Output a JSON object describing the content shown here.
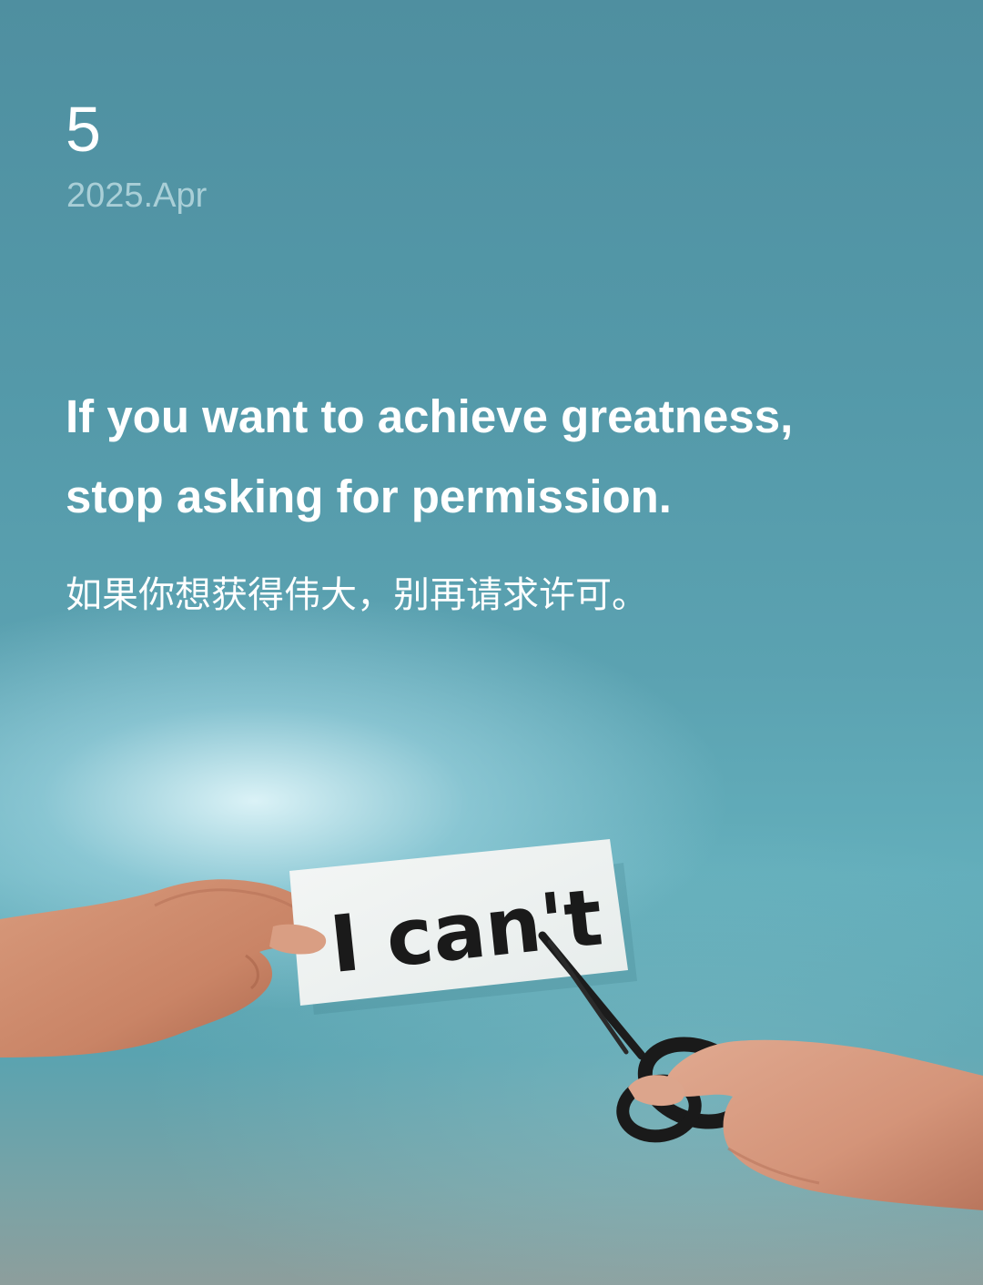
{
  "date": {
    "day": "5",
    "month_year": "2025.Apr"
  },
  "quote": {
    "english_line_1": "If you want to achieve greatness,",
    "english_line_2": "stop asking for permission.",
    "chinese": "如果你想获得伟大，别再请求许可。"
  },
  "photo": {
    "sign_text": "I can't"
  },
  "colors": {
    "background_top": "#4f8fa0",
    "background_mid": "#5ba2b1",
    "text_primary": "#ffffff",
    "text_secondary": "#a9cfd7"
  }
}
